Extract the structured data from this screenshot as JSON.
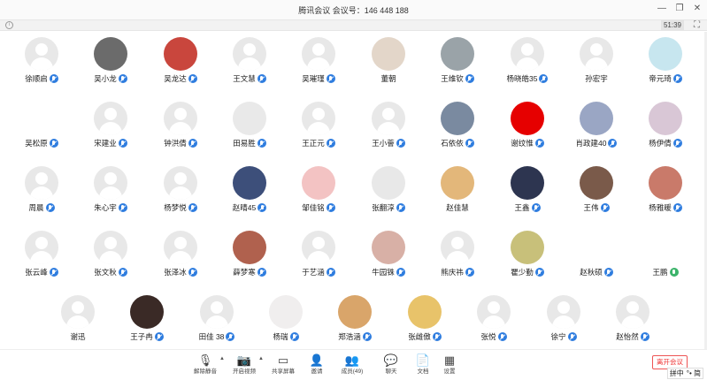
{
  "window": {
    "title": "腾讯会议 会议号：146 448 188",
    "controls": [
      "minimize-icon",
      "restore-icon",
      "close-icon"
    ]
  },
  "topbar": {
    "timer": "51:39"
  },
  "rows": [
    [
      {
        "name": "徐顺启",
        "mic": "muted",
        "avatar": "default"
      },
      {
        "name": "吴小龙",
        "mic": "muted",
        "avatar": "photo",
        "color": "#6b6b6b"
      },
      {
        "name": "吴龙达",
        "mic": "muted",
        "avatar": "photo",
        "color": "#c9463d"
      },
      {
        "name": "王文慧",
        "mic": "muted",
        "avatar": "default"
      },
      {
        "name": "吴璀瑾",
        "mic": "muted",
        "avatar": "default"
      },
      {
        "name": "董朝",
        "mic": "none",
        "avatar": "photo",
        "color": "#e3d6c9"
      },
      {
        "name": "王维钦",
        "mic": "muted",
        "avatar": "photo",
        "color": "#9aa3a8"
      },
      {
        "name": "杨晓皓35",
        "mic": "muted",
        "avatar": "default"
      },
      {
        "name": "孙宏宇",
        "mic": "none",
        "avatar": "default"
      },
      {
        "name": "帝元琦",
        "mic": "muted",
        "avatar": "photo",
        "color": "#c7e6ef"
      }
    ],
    [
      {
        "name": "吴松原",
        "mic": "muted",
        "avatar": "none"
      },
      {
        "name": "宋建业",
        "mic": "muted",
        "avatar": "default"
      },
      {
        "name": "钟洪倩",
        "mic": "muted",
        "avatar": "default"
      },
      {
        "name": "田易胜",
        "mic": "muted",
        "avatar": "photo",
        "color": "#e9e9e9"
      },
      {
        "name": "王正元",
        "mic": "muted",
        "avatar": "default"
      },
      {
        "name": "王小薈",
        "mic": "muted",
        "avatar": "default"
      },
      {
        "name": "石依依",
        "mic": "muted",
        "avatar": "photo",
        "color": "#7a8aa0"
      },
      {
        "name": "谢纹惟",
        "mic": "muted",
        "avatar": "photo",
        "color": "#e60000"
      },
      {
        "name": "肖政建40",
        "mic": "muted",
        "avatar": "photo",
        "color": "#9aa6c4"
      },
      {
        "name": "杨伊倩",
        "mic": "muted",
        "avatar": "photo",
        "color": "#d9c7d6"
      }
    ],
    [
      {
        "name": "周晨",
        "mic": "muted",
        "avatar": "default"
      },
      {
        "name": "朱心宇",
        "mic": "muted",
        "avatar": "default"
      },
      {
        "name": "杨梦悦",
        "mic": "muted",
        "avatar": "default"
      },
      {
        "name": "赵晴45",
        "mic": "muted",
        "avatar": "photo",
        "color": "#3d4f7a"
      },
      {
        "name": "邹佳铭",
        "mic": "muted",
        "avatar": "photo",
        "color": "#f3c3c3"
      },
      {
        "name": "张翻淳",
        "mic": "muted",
        "avatar": "photo",
        "color": "#e8e8e8"
      },
      {
        "name": "赵佳慧",
        "mic": "none",
        "avatar": "photo",
        "color": "#e3b77a"
      },
      {
        "name": "王鑫",
        "mic": "muted",
        "avatar": "photo",
        "color": "#2d3550"
      },
      {
        "name": "王伟",
        "mic": "muted",
        "avatar": "photo",
        "color": "#7a5a4a"
      },
      {
        "name": "杨雅暖",
        "mic": "muted",
        "avatar": "photo",
        "color": "#c97a6a"
      }
    ],
    [
      {
        "name": "张云峰",
        "mic": "muted",
        "avatar": "default"
      },
      {
        "name": "张文秋",
        "mic": "muted",
        "avatar": "default"
      },
      {
        "name": "张泽冰",
        "mic": "muted",
        "avatar": "default"
      },
      {
        "name": "薛梦寒",
        "mic": "muted",
        "avatar": "photo",
        "color": "#b0614e"
      },
      {
        "name": "于艺涵",
        "mic": "muted",
        "avatar": "default"
      },
      {
        "name": "牛园铢",
        "mic": "muted",
        "avatar": "photo",
        "color": "#d8b0a6"
      },
      {
        "name": "熊庆祎",
        "mic": "muted",
        "avatar": "default"
      },
      {
        "name": "瞿少勤",
        "mic": "muted",
        "avatar": "photo",
        "color": "#c8c07a"
      },
      {
        "name": "赵秋硕",
        "mic": "muted",
        "avatar": "none"
      },
      {
        "name": "王鹏",
        "mic": "green",
        "avatar": "none"
      }
    ],
    [
      {
        "name": "谢迅",
        "mic": "none",
        "avatar": "default"
      },
      {
        "name": "王子冉",
        "mic": "muted",
        "avatar": "photo",
        "color": "#3a2a26"
      },
      {
        "name": "田佳 38",
        "mic": "muted",
        "avatar": "default"
      },
      {
        "name": "杨瑞",
        "mic": "muted",
        "avatar": "photo",
        "color": "#f0eeee"
      },
      {
        "name": "郑浩涵",
        "mic": "muted",
        "avatar": "photo",
        "color": "#d9a56a"
      },
      {
        "name": "张雌傲",
        "mic": "muted",
        "avatar": "photo",
        "color": "#e8c36a"
      },
      {
        "name": "张悦",
        "mic": "muted",
        "avatar": "default"
      },
      {
        "name": "徐宁",
        "mic": "muted",
        "avatar": "default"
      },
      {
        "name": "赵怡然",
        "mic": "muted",
        "avatar": "default"
      }
    ]
  ],
  "toolbar": {
    "items": [
      {
        "label": "解除静音",
        "icon": "mic-off-icon",
        "glyph": "🎙"
      },
      {
        "label": "开启视频",
        "icon": "camera-off-icon",
        "glyph": "📷"
      },
      {
        "label": "共享屏幕",
        "icon": "share-screen-icon",
        "glyph": "▭"
      },
      {
        "label": "邀请",
        "icon": "invite-icon",
        "glyph": "👤"
      },
      {
        "label": "成员(49)",
        "icon": "members-icon",
        "glyph": "👥"
      },
      {
        "label": "聊天",
        "icon": "chat-icon",
        "glyph": "💬"
      },
      {
        "label": "文档",
        "icon": "document-icon",
        "glyph": "📄"
      },
      {
        "label": "设置",
        "icon": "settings-icon",
        "glyph": "▦"
      }
    ],
    "leave_label": "离开会议"
  },
  "ime": {
    "label": "拼中",
    "extra": "°• 简"
  }
}
